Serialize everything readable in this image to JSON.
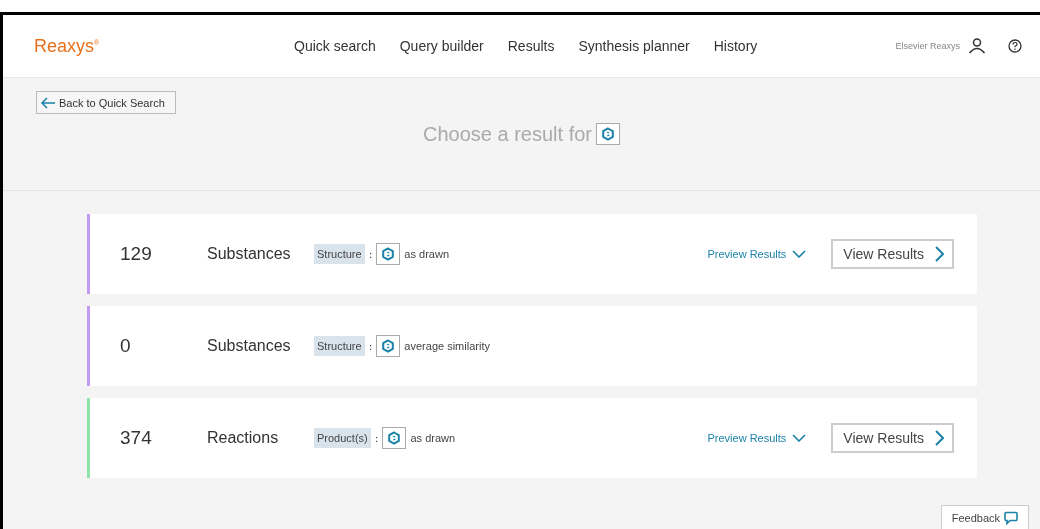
{
  "header": {
    "brand": "Reaxys",
    "brand_mark": "®",
    "nav": [
      "Quick search",
      "Query builder",
      "Results",
      "Synthesis planner",
      "History"
    ],
    "user": "Elsevier Reaxys"
  },
  "back_button": "Back to Quick Search",
  "title": "Choose a result for",
  "results": [
    {
      "count": "129",
      "type": "Substances",
      "field": "Structure",
      "separator": ":",
      "match": "as drawn",
      "color": "#c39bf0",
      "preview": "Preview Results",
      "view": "View Results"
    },
    {
      "count": "0",
      "type": "Substances",
      "field": "Structure",
      "separator": ":",
      "match": "average similarity",
      "color": "#c39bf0"
    },
    {
      "count": "374",
      "type": "Reactions",
      "field": "Product(s)",
      "separator": ":",
      "match": "as drawn",
      "color": "#8ee3a6",
      "preview": "Preview Results",
      "view": "View Results"
    }
  ],
  "feedback": "Feedback"
}
